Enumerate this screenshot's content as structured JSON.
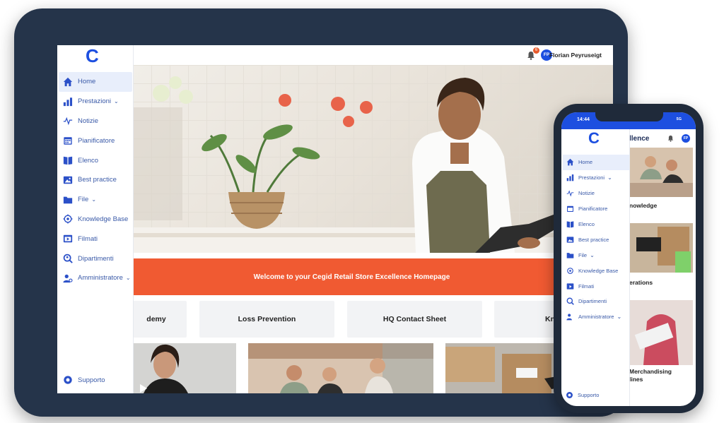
{
  "brand": {
    "logo_letter": "C",
    "accent": "#1d4fe0",
    "banner_color": "#f05a32"
  },
  "tablet": {
    "sidebar": {
      "items": [
        {
          "label": "Home",
          "icon": "home-icon",
          "active": true
        },
        {
          "label": "Prestazioni",
          "icon": "bar-chart-icon",
          "chevron": "⌄"
        },
        {
          "label": "Notizie",
          "icon": "pulse-icon"
        },
        {
          "label": "Pianificatore",
          "icon": "calendar-icon"
        },
        {
          "label": "Elenco",
          "icon": "book-icon"
        },
        {
          "label": "Best practice",
          "icon": "image-icon"
        },
        {
          "label": "File",
          "icon": "folder-icon",
          "chevron": "⌄"
        },
        {
          "label": "Knowledge Base",
          "icon": "target-icon"
        },
        {
          "label": "Filmati",
          "icon": "video-icon"
        },
        {
          "label": "Dipartimenti",
          "icon": "department-icon"
        },
        {
          "label": "Amministratore",
          "icon": "admin-icon",
          "chevron": "⌄"
        }
      ],
      "support": "Supporto"
    },
    "topbar": {
      "notifications": "6",
      "avatar_initials": "FP",
      "user_name": "Florian Peyruseigt"
    },
    "banner": "Welcome to your Cegid Retail Store Excellence Homepage",
    "cards": [
      "demy",
      "Loss Prevention",
      "HQ Contact Sheet",
      "Knowledge"
    ]
  },
  "phone": {
    "status": {
      "time": "14:44",
      "signal": "5G"
    },
    "title": "llence",
    "avatar_initials": "FP",
    "sidebar": {
      "items": [
        {
          "label": "Home",
          "icon": "home-icon",
          "active": true
        },
        {
          "label": "Prestazioni",
          "icon": "bar-chart-icon",
          "chevron": "⌄"
        },
        {
          "label": "Notizie",
          "icon": "pulse-icon"
        },
        {
          "label": "Pianificatore",
          "icon": "calendar-icon"
        },
        {
          "label": "Elenco",
          "icon": "book-icon"
        },
        {
          "label": "Best practice",
          "icon": "image-icon"
        },
        {
          "label": "File",
          "icon": "folder-icon",
          "chevron": "⌄"
        },
        {
          "label": "Knowledge Base",
          "icon": "target-icon"
        },
        {
          "label": "Filmati",
          "icon": "video-icon"
        },
        {
          "label": "Dipartimenti",
          "icon": "department-icon"
        },
        {
          "label": "Amministratore",
          "icon": "admin-icon",
          "chevron": "⌄"
        }
      ],
      "support": "Supporto"
    },
    "captions": [
      "nowledge",
      "erations",
      "Merchandising",
      "lines"
    ]
  }
}
